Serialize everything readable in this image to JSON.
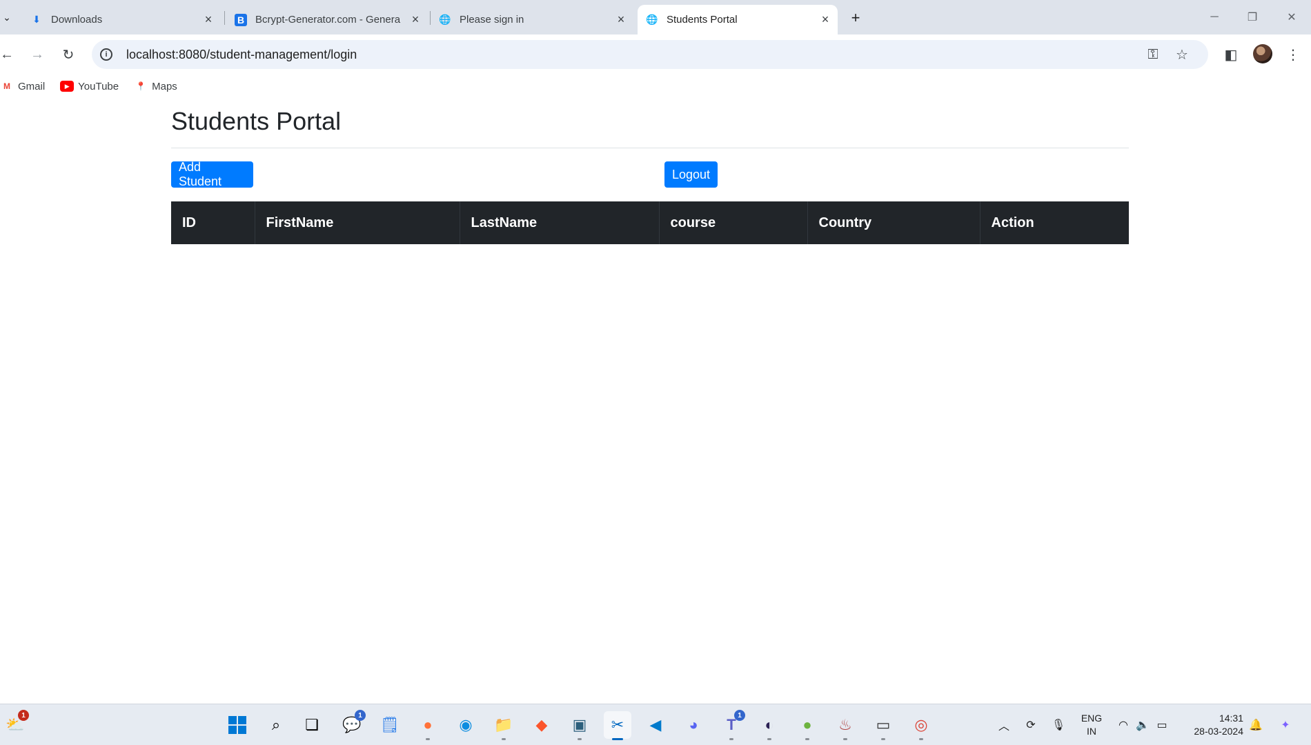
{
  "browser": {
    "tabs": [
      {
        "label": "Downloads",
        "icon": "download-icon"
      },
      {
        "label": "Bcrypt-Generator.com - Genera",
        "icon": "bcrypt-favicon"
      },
      {
        "label": "Please sign in",
        "icon": "globe-icon"
      },
      {
        "label": "Students Portal",
        "icon": "globe-icon",
        "active": true
      }
    ],
    "url": "localhost:8080/student-management/login",
    "bookmarks": [
      {
        "label": "Gmail",
        "icon": "gmail-icon"
      },
      {
        "label": "YouTube",
        "icon": "youtube-icon"
      },
      {
        "label": "Maps",
        "icon": "maps-icon"
      }
    ]
  },
  "page": {
    "title": "Students Portal",
    "add_button": "Add Student",
    "logout_button": "Logout",
    "table": {
      "columns": [
        "ID",
        "FirstName",
        "LastName",
        "course",
        "Country",
        "Action"
      ],
      "rows": []
    }
  },
  "taskbar": {
    "weather_badge": "1",
    "chat_badge": "1",
    "teams_badge": "1",
    "language": "ENG",
    "region": "IN",
    "time": "14:31",
    "date": "28-03-2024"
  },
  "colors": {
    "primary_button": "#007bff",
    "table_header": "#212529",
    "tabbar": "#dee3eb"
  }
}
